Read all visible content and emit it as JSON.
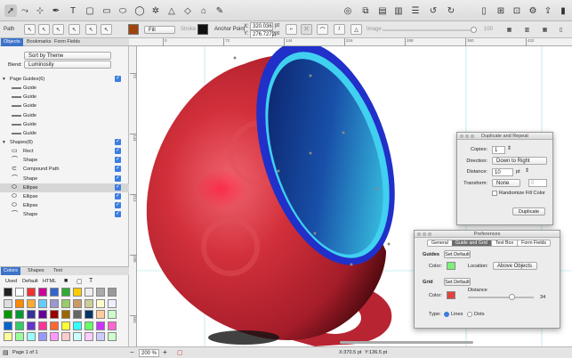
{
  "toolbar": {
    "tools": [
      "arrow-icon",
      "bezier-tool-icon",
      "anchor-tool-icon",
      "pen-icon",
      "text-tool-icon",
      "rect-icon",
      "rounded-rect-icon",
      "ellipse-icon",
      "star-icon",
      "polygon-icon",
      "eraser-icon",
      "brush-icon"
    ],
    "right_icons": [
      "group-icon",
      "combine-icon",
      "frame-icon",
      "align-icon",
      "layers-icon",
      "rotate-left-icon",
      "rotate-right-icon",
      "window-icon",
      "crop-icon",
      "zoom-icon",
      "gear-icon",
      "share-icon",
      "sidebar-icon"
    ]
  },
  "props": {
    "path_label": "Path",
    "fill_label": "Fill",
    "stroke_label": "Stroke",
    "anchor_label": "Anchor Point",
    "x_label": "X:",
    "y_label": "Y:",
    "x_value": "320.036",
    "y_value": "276.7272",
    "unit": "pt",
    "image_label": "Image",
    "opacity_value": "100",
    "fill_color": "#a0440c",
    "stroke_color": "#111111"
  },
  "sidebar": {
    "tabs": [
      "Objects",
      "Bookmarks",
      "Form Fields"
    ],
    "sort_label": "Sort by Theme",
    "blend_label": "Blend:",
    "blend_value": "Luminosity",
    "guides_header": "Page Guides(6)",
    "guides": [
      "Guide",
      "Guide",
      "Guide",
      "Guide",
      "Guide",
      "Guide"
    ],
    "shapes_header": "Shapes(8)",
    "shapes": [
      "Rect",
      "Shape",
      "Compound Path",
      "Shape",
      "Ellipse",
      "Ellipse",
      "Ellipse",
      "Shape"
    ],
    "palette_tabs": [
      "Colors",
      "Shapes",
      "Text"
    ],
    "palette_modes": [
      "Used",
      "Default",
      "HTML"
    ]
  },
  "rulers": {
    "h_ticks": [
      "0",
      "72",
      "144",
      "216",
      "288",
      "360",
      "432"
    ],
    "v_ticks": [
      "72",
      "144",
      "216",
      "288",
      "360"
    ]
  },
  "status": {
    "zoom": "200 %",
    "page_label": "Page 1 of 1",
    "coord_x": "X:370.5 pt",
    "coord_y": "Y:136.5 pt"
  },
  "duplicate_panel": {
    "title": "Duplicate and Repeat",
    "copies_label": "Copies:",
    "copies_value": "1",
    "direction_label": "Direction:",
    "direction_value": "Down to Right",
    "distance_label": "Distance:",
    "distance_value": "10",
    "distance_unit": "pt",
    "transform_label": "Transform:",
    "transform_value": "None",
    "transform_amount": "0",
    "randomize_label": "Randomize Fill Color",
    "button_label": "Duplicate"
  },
  "prefs_panel": {
    "title": "Preferences",
    "tabs": [
      "General",
      "Guide and Grid",
      "Text Box",
      "Form Fields"
    ],
    "guides_label": "Guides",
    "guides_set_default": "Set Default",
    "guides_color_label": "Color:",
    "guides_color": "#7df07a",
    "location_label": "Location:",
    "location_value": "Above Objects",
    "grid_label": "Grid",
    "grid_set_default": "Set Default",
    "grid_color_label": "Color:",
    "grid_color": "#e0443c",
    "distance_label": "Distance",
    "distance_value": "34",
    "type_label": "Type:",
    "type_lines": "Lines",
    "type_dots": "Dots"
  },
  "colors": {
    "accent": "#3d73c9",
    "cup_red": "#d2303a",
    "rim_blue": "#2040d8",
    "inner_cyan": "#40e0f0"
  }
}
